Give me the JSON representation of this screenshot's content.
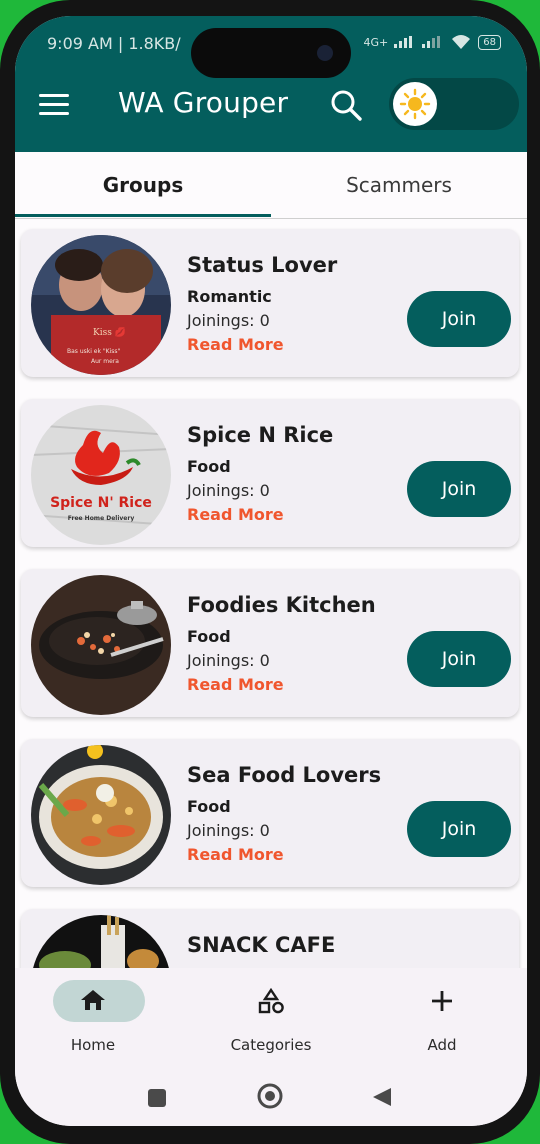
{
  "status_bar": {
    "time": "9:09 AM | 1.8KB/",
    "network": "4G+",
    "battery": "68"
  },
  "appbar": {
    "menu_icon": "hamburger-menu-icon",
    "title": "WA Grouper",
    "search_icon": "search-icon",
    "theme_icon": "sun-icon",
    "color": "#045e5d"
  },
  "tabs": [
    {
      "label": "Groups",
      "active": true
    },
    {
      "label": "Scammers",
      "active": false
    }
  ],
  "groups": [
    {
      "name": "Status Lover",
      "category": "Romantic",
      "joinings": "Joinings: 0",
      "read_more": "Read More",
      "join": "Join",
      "image": "couple-photo"
    },
    {
      "name": "Spice N Rice",
      "category": "Food",
      "joinings": "Joinings: 0",
      "read_more": "Read More",
      "join": "Join",
      "image": "chili-logo",
      "logo_text": "Spice N' Rice",
      "logo_sub": "Free Home Delivery"
    },
    {
      "name": "Foodies Kitchen",
      "category": "Food",
      "joinings": "Joinings: 0",
      "read_more": "Read More",
      "join": "Join",
      "image": "wok-photo"
    },
    {
      "name": "Sea Food Lovers",
      "category": "Food",
      "joinings": "Joinings: 0",
      "read_more": "Read More",
      "join": "Join",
      "image": "seafood-platter-photo"
    },
    {
      "name": "SNACK CAFE",
      "category": "",
      "joinings": "",
      "read_more": "",
      "join": "",
      "image": "cafe-photo"
    }
  ],
  "bottom_nav": [
    {
      "label": "Home",
      "icon": "home-icon",
      "active": true
    },
    {
      "label": "Categories",
      "icon": "shapes-icon",
      "active": false
    },
    {
      "label": "Add",
      "icon": "plus-icon",
      "active": false
    }
  ],
  "system_nav": [
    "recents-square-icon",
    "home-circle-icon",
    "back-triangle-icon"
  ],
  "colors": {
    "primary": "#045e5d",
    "accent_text": "#f0562e",
    "card_bg": "#f2eff4",
    "nav_pill": "#c2d6d4"
  }
}
